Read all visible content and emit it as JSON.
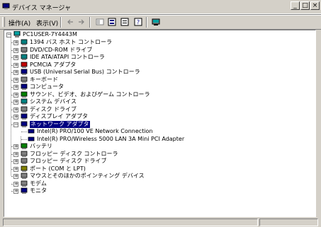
{
  "window": {
    "title": "デバイス マネージャ",
    "minimize": "_",
    "maximize": "□",
    "close": "×"
  },
  "menu": {
    "action": "操作(A)",
    "view": "表示(V)"
  },
  "toolbar": {
    "back": "back-icon",
    "forward": "forward-icon",
    "buttons": [
      "tree-view-icon",
      "details-icon",
      "properties-icon",
      "help-icon",
      "scan-icon"
    ]
  },
  "tree": {
    "root": "PC1USER-7Y4443M",
    "items": [
      "1394 バス ホスト コントローラ",
      "DVD/CD-ROM ドライブ",
      "IDE ATA/ATAPI コントローラ",
      "PCMCIA アダプタ",
      "USB (Universal Serial Bus) コントローラ",
      "キーボード",
      "コンピュータ",
      "サウンド、ビデオ、およびゲーム コントローラ",
      "システム デバイス",
      "ディスク ドライブ",
      "ディスプレイ アダプタ",
      "ネットワーク アダプタ",
      "バッテリ",
      "フロッピー ディスク コントローラ",
      "フロッピー ディスク ドライブ",
      "ポート (COM と LPT)",
      "マウスとそのほかのポインティング デバイス",
      "モデム",
      "モニタ"
    ],
    "network_children": [
      "Intel(R) PRO/100 VE Network Connection",
      "Intel(R) PRO/Wireless 5000 LAN 3A Mini PCI Adapter"
    ],
    "expanded_symbol": "−",
    "collapsed_symbol": "+"
  }
}
